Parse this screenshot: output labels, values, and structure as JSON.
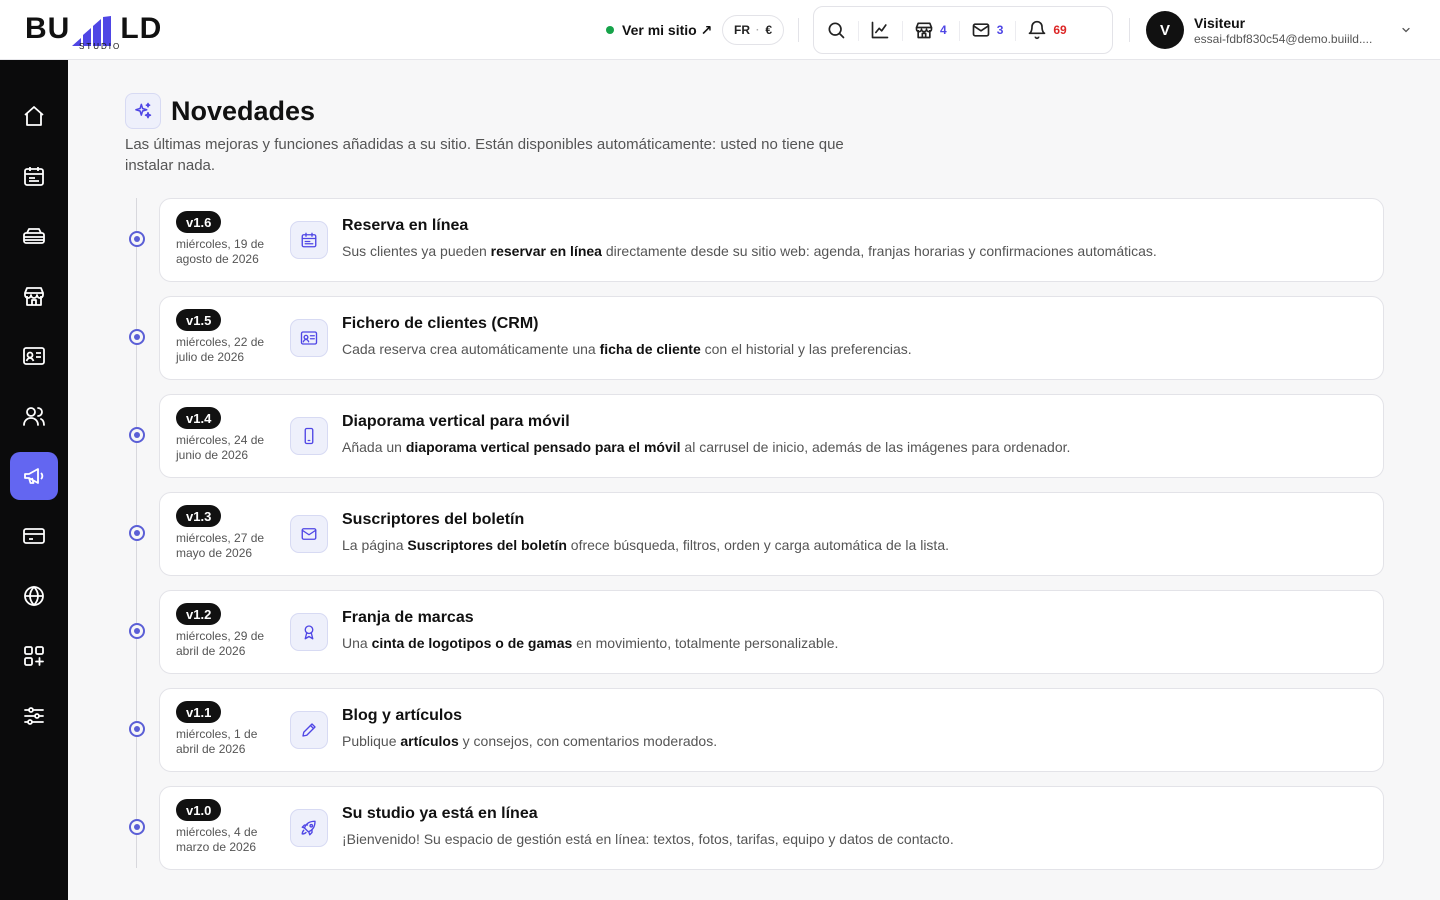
{
  "header": {
    "logo_text_left": "BU",
    "logo_text_right": "LD",
    "logo_sub": "STUDIO",
    "site_link": "Ver mi sitio ↗",
    "locale": {
      "lang": "FR",
      "sep": "·",
      "currency": "€"
    },
    "toolbar": {
      "shop_count": "4",
      "mail_count": "3",
      "notif_count": "69"
    },
    "user": {
      "initial": "V",
      "name": "Visiteur",
      "email": "essai-fdbf830c54@demo.buiild...."
    }
  },
  "page": {
    "title": "Novedades",
    "description": "Las últimas mejoras y funciones añadidas a su sitio. Están disponibles automáticamente: usted no tiene que instalar nada."
  },
  "releases": [
    {
      "version": "v1.6",
      "date": "miércoles, 19 de agosto de 2026",
      "title": "Reserva en línea",
      "desc_pre": "Sus clientes ya pueden ",
      "desc_bold": "reservar en línea",
      "desc_post": " directamente desde su sitio web: agenda, franjas horarias y confirmaciones automáticas.",
      "icon": "calendar-icon"
    },
    {
      "version": "v1.5",
      "date": "miércoles, 22 de julio de 2026",
      "title": "Fichero de clientes (CRM)",
      "desc_pre": "Cada reserva crea automáticamente una ",
      "desc_bold": "ficha de cliente",
      "desc_post": " con el historial y las preferencias.",
      "icon": "id-card-icon"
    },
    {
      "version": "v1.4",
      "date": "miércoles, 24 de junio de 2026",
      "title": "Diaporama vertical para móvil",
      "desc_pre": "Añada un ",
      "desc_bold": "diaporama vertical pensado para el móvil",
      "desc_post": " al carrusel de inicio, además de las imágenes para ordenador.",
      "icon": "smartphone-icon"
    },
    {
      "version": "v1.3",
      "date": "miércoles, 27 de mayo de 2026",
      "title": "Suscriptores del boletín",
      "desc_pre": "La página ",
      "desc_bold": "Suscriptores del boletín",
      "desc_post": " ofrece búsqueda, filtros, orden y carga automática de la lista.",
      "icon": "mail-icon"
    },
    {
      "version": "v1.2",
      "date": "miércoles, 29 de abril de 2026",
      "title": "Franja de marcas",
      "desc_pre": "Una ",
      "desc_bold": "cinta de logotipos o de gamas",
      "desc_post": " en movimiento, totalmente personalizable.",
      "icon": "award-icon"
    },
    {
      "version": "v1.1",
      "date": "miércoles, 1 de abril de 2026",
      "title": "Blog y artículos",
      "desc_pre": "Publique ",
      "desc_bold": "artículos",
      "desc_post": " y consejos, con comentarios moderados.",
      "icon": "pencil-icon"
    },
    {
      "version": "v1.0",
      "date": "miércoles, 4 de marzo de 2026",
      "title": "Su studio ya está en línea",
      "desc_pre": "¡Bienvenido! Su espacio de gestión está en línea: textos, fotos, tarifas, equipo y datos de contacto.",
      "desc_bold": "",
      "desc_post": "",
      "icon": "rocket-icon"
    }
  ],
  "colors": {
    "accent": "#6366f1",
    "sidebar_bg": "#0b0b0c",
    "online": "#16a34a",
    "notif": "#dc2626"
  }
}
